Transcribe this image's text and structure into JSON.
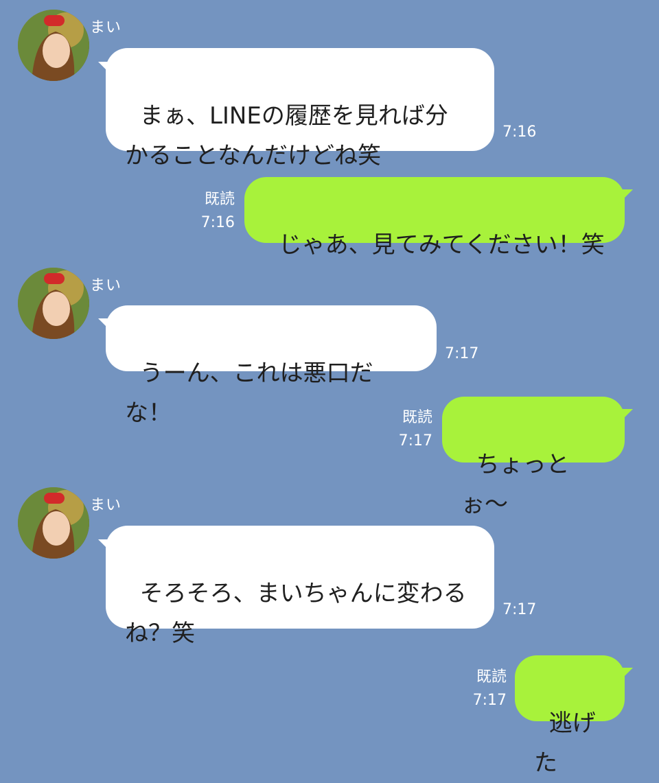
{
  "colors": {
    "background": "#7494c0",
    "incoming_bubble": "#ffffff",
    "outgoing_bubble": "#a8f23b"
  },
  "messages": [
    {
      "sender": "まい",
      "text": "まぁ、LINEの履歴を見れば分\nかることなんだけどね笑",
      "time": "7:16"
    },
    {
      "read_label": "既読",
      "text": "じゃあ、見てみてください！笑",
      "time": "7:16"
    },
    {
      "sender": "まい",
      "text": "うーん、これは悪口だな！",
      "time": "7:17"
    },
    {
      "read_label": "既読",
      "text": "ちょっとぉ〜",
      "time": "7:17"
    },
    {
      "sender": "まい",
      "text": "そろそろ、まいちゃんに変わる\nね？笑",
      "time": "7:17"
    },
    {
      "read_label": "既読",
      "text": "逃げた",
      "time": "7:17"
    }
  ]
}
